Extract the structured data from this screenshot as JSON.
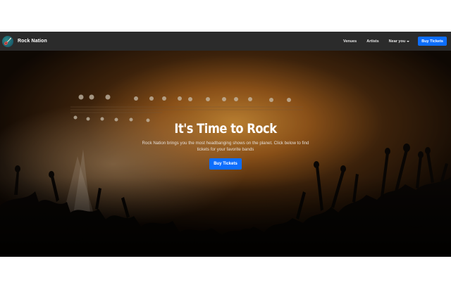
{
  "navbar": {
    "brand": "Rock Nation",
    "brand_logo_icon": "guitar-icon",
    "links": [
      "Venues",
      "Artists",
      "Near you"
    ],
    "cta": "Buy Tickets"
  },
  "hero": {
    "title": "It's Time to Rock",
    "text": "Rock Nation brings you the most headbanging shows on the planet. Click below to find tickets for your favorite bands",
    "cta": "Buy Tickets"
  },
  "colors": {
    "navbar_bg": "#2b2b2b",
    "button": "#0d6efd",
    "hero_glow": "#c07a28"
  }
}
